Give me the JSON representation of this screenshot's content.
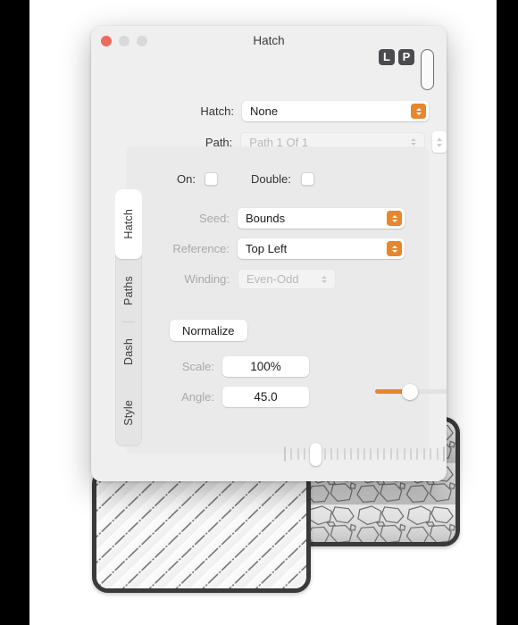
{
  "window": {
    "title": "Hatch",
    "traffic_lights": [
      "close",
      "minimize",
      "maximize"
    ],
    "badges": [
      {
        "name": "L",
        "label": "L"
      },
      {
        "name": "P",
        "label": "P"
      }
    ]
  },
  "form": {
    "hatch": {
      "label": "Hatch:",
      "value": "None",
      "enabled": true
    },
    "path": {
      "label": "Path:",
      "value": "Path 1 Of 1",
      "enabled": false
    }
  },
  "tabs": {
    "items": [
      {
        "label": "Hatch",
        "selected": true
      },
      {
        "label": "Paths",
        "selected": false
      },
      {
        "label": "Dash",
        "selected": false
      },
      {
        "label": "Style",
        "selected": false
      }
    ]
  },
  "panel": {
    "on": {
      "label": "On:",
      "checked": false
    },
    "double": {
      "label": "Double:",
      "checked": false
    },
    "seed": {
      "label": "Seed:",
      "value": "Bounds",
      "enabled": true
    },
    "reference": {
      "label": "Reference:",
      "value": "Top Left",
      "enabled": true
    },
    "winding": {
      "label": "Winding:",
      "value": "Even-Odd",
      "enabled": false
    },
    "normalize": {
      "label": "Normalize"
    },
    "scale": {
      "label": "Scale:",
      "value": "100%",
      "slider_percent": 35
    },
    "angle": {
      "label": "Angle:",
      "value": "45.0",
      "slider_percent": 21
    }
  },
  "colors": {
    "accent": "#e8862c",
    "window_bg": "#f0efef",
    "panel_bg": "#eaeaea",
    "close_button": "#ed6a5e",
    "inactive_button": "#d9d9d9",
    "shape_stroke": "#3a3a3a"
  },
  "preview_shapes": [
    {
      "name": "dash-dot-hatch-shape"
    },
    {
      "name": "stone-hatch-shape"
    }
  ]
}
